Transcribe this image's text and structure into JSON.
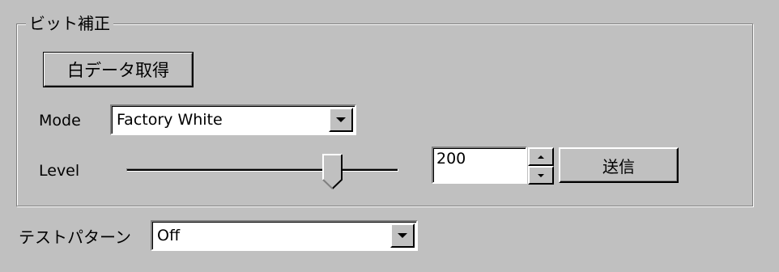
{
  "bit_correction": {
    "group_title": "ビット補正",
    "acquire_white_button": "白データ取得",
    "mode_label": "Mode",
    "mode_value": "Factory White",
    "level_label": "Level",
    "level_value": "200",
    "level_slider_fraction": 0.76,
    "send_button": "送信"
  },
  "test_pattern": {
    "label": "テストパターン",
    "value": "Off"
  },
  "icons": [
    "dropdown-arrow-icon",
    "spin-up-icon",
    "spin-down-icon",
    "slider-thumb-icon"
  ],
  "colors": {
    "face": "#c0c0c0",
    "shadow": "#808080",
    "highlight": "#ffffff"
  }
}
